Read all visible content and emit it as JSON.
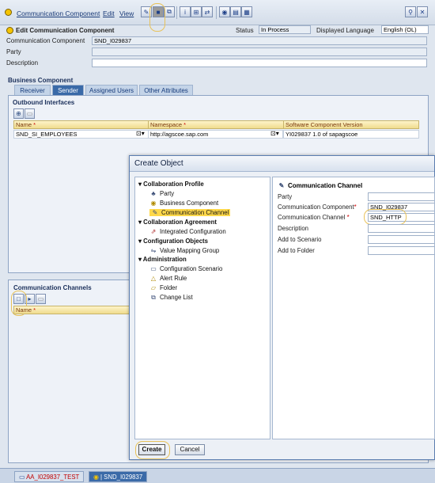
{
  "menubar": {
    "items": [
      "Communication Component",
      "Edit",
      "View"
    ]
  },
  "header": {
    "title": "Edit Communication Component",
    "status_label": "Status",
    "status_value": "In Process",
    "language_label": "Displayed Language",
    "language_value": "English (OL)",
    "comm_component_label": "Communication Component",
    "comm_component_value": "SND_I029837",
    "party_label": "Party",
    "party_value": "",
    "description_label": "Description",
    "description_value": ""
  },
  "business_component": {
    "title": "Business Component",
    "tabs": [
      "Receiver",
      "Sender",
      "Assigned Users",
      "Other Attributes"
    ],
    "active_tab": "Sender"
  },
  "outbound": {
    "title": "Outbound Interfaces",
    "columns": [
      "Name",
      "Namespace",
      "Software Component Version"
    ],
    "rows": [
      [
        "SND_SI_EMPLOYEES",
        "http://agscoe.sap.com",
        "YI029837 1.0 of sapagscoe"
      ]
    ]
  },
  "comm_channels": {
    "title": "Communication Channels",
    "column": "Name"
  },
  "dialog": {
    "title": "Create Object",
    "tree": [
      {
        "label": "Collaboration Profile",
        "type": "category"
      },
      {
        "label": "Party",
        "type": "item",
        "icon": "party-icon"
      },
      {
        "label": "Business Component",
        "type": "item",
        "icon": "business-component-icon"
      },
      {
        "label": "Communication Channel",
        "type": "item",
        "icon": "channel-icon",
        "selected": true
      },
      {
        "label": "Collaboration Agreement",
        "type": "category"
      },
      {
        "label": "Integrated Configuration",
        "type": "item",
        "icon": "config-icon"
      },
      {
        "label": "Configuration Objects",
        "type": "category"
      },
      {
        "label": "Value Mapping Group",
        "type": "item",
        "icon": "mapping-icon"
      },
      {
        "label": "Administration",
        "type": "category"
      },
      {
        "label": "Configuration Scenario",
        "type": "item",
        "icon": "scenario-icon"
      },
      {
        "label": "Alert Rule",
        "type": "item",
        "icon": "alert-icon"
      },
      {
        "label": "Folder",
        "type": "item",
        "icon": "folder-icon"
      },
      {
        "label": "Change List",
        "type": "item",
        "icon": "changelist-icon"
      }
    ],
    "form_title": "Communication Channel",
    "form": {
      "party_label": "Party",
      "party_value": "",
      "comm_component_label": "Communication Component",
      "comm_component_value": "SND_I029837",
      "comm_channel_label": "Communication Channel",
      "comm_channel_value": "SND_HTTP",
      "description_label": "Description",
      "description_value": "",
      "add_scenario_label": "Add to Scenario",
      "add_scenario_value": "",
      "add_folder_label": "Add to Folder",
      "add_folder_value": ""
    },
    "create_label": "Create",
    "cancel_label": "Cancel"
  },
  "statusbar": {
    "tab1": "AA_I029837_TEST",
    "tab2": "| SND_I029837"
  },
  "colors": {
    "accent": "#3a6aa8",
    "selection": "#ffd84a",
    "highlight_ring": "#e8c25a",
    "required": "#cc0000"
  }
}
